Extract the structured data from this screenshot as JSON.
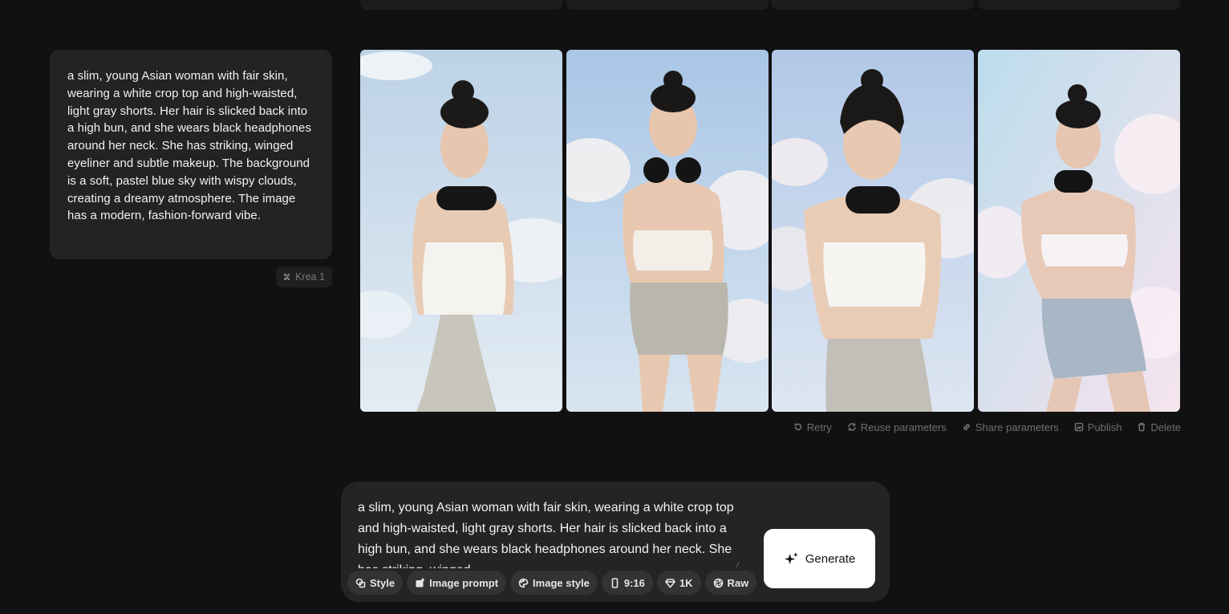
{
  "history": {
    "prompt": "a slim, young Asian woman with fair skin, wearing a white crop top and high-waisted, light gray shorts. Her hair is slicked back into a high bun, and she wears black headphones around her neck. She has striking, winged eyeliner and subtle makeup. The background is a soft, pastel blue sky with wispy clouds, creating a dreamy atmosphere. The image has a modern, fashion-forward vibe.",
    "model": "Krea 1"
  },
  "actions": {
    "retry": "Retry",
    "reuse": "Reuse parameters",
    "share": "Share parameters",
    "publish": "Publish",
    "delete": "Delete"
  },
  "composer": {
    "text": "a slim, young Asian woman with fair skin, wearing a white crop top and high-waisted, light gray shorts. Her hair is slicked back into a high bun, and she wears black headphones around her neck. She has striking, winged",
    "chips": {
      "style": "Style",
      "image_prompt": "Image prompt",
      "image_style": "Image style",
      "aspect": "9:16",
      "resolution": "1K",
      "raw": "Raw"
    },
    "generate": "Generate"
  },
  "colors": {
    "background": "#111111",
    "card": "#232323",
    "sky": "#b9cfe8",
    "button": "#ffffff"
  }
}
